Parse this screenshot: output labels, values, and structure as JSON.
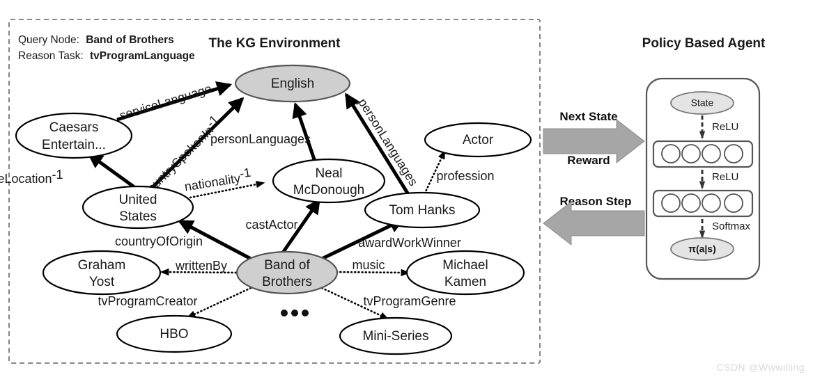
{
  "kg_panel": {
    "title": "The KG Environment",
    "query_node_label": "Query Node:",
    "query_node_value": "Band of Brothers",
    "reason_task_label": "Reason Task:",
    "reason_task_value": "tvProgramLanguage",
    "ellipsis": "•••"
  },
  "nodes": {
    "english": "English",
    "caesars": "Caesars\nEntertain...",
    "caesars_line1": "Caesars",
    "caesars_line2": "Entertain...",
    "united_states_line1": "United",
    "united_states_line2": "States",
    "neal_line1": "Neal",
    "neal_line2": "McDonough",
    "tom_hanks": "Tom Hanks",
    "actor": "Actor",
    "band_line1": "Band of",
    "band_line2": "Brothers",
    "graham_line1": "Graham",
    "graham_line2": "Yost",
    "michael_line1": "Michael",
    "michael_line2": "Kamen",
    "hbo": "HBO",
    "mini_series": "Mini-Series"
  },
  "edges": {
    "service_language": "serviceLanguage",
    "country_spoken_in": "countrySpokenIn",
    "country_spoken_in_sup": "-1",
    "person_languages": "personLanguages",
    "person_languages_2": "personLanguages",
    "service_location": "serviceLocation",
    "service_location_sup": "-1",
    "nationality": "nationality",
    "nationality_sup": "-1",
    "profession": "profession",
    "cast_actor": "castActor",
    "country_of_origin": "countryOfOrigin",
    "award_work_winner": "awardWorkWinner",
    "written_by": "writtenBy",
    "music": "music",
    "tv_program_creator": "tvProgramCreator",
    "tv_program_genre": "tvProgramGenre"
  },
  "agent_panel": {
    "title": "Policy Based Agent",
    "state": "State",
    "policy_output": "π(a|s)",
    "activation_1": "ReLU",
    "activation_2": "ReLU",
    "activation_3": "Softmax"
  },
  "interaction_arrows": {
    "next_state": "Next State",
    "reward": "Reward",
    "reason_step": "Reason Step"
  },
  "watermark": "CSDN @Wwwilling",
  "colors": {
    "shaded_node": "#cfcfcf",
    "arrow_gray": "#a6a6a6",
    "frame_gray": "#777777"
  }
}
